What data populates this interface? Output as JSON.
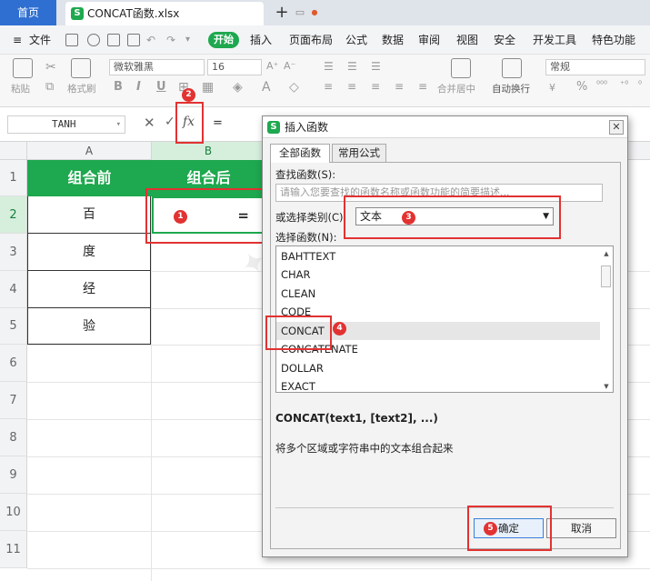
{
  "tabs": {
    "home": "首页",
    "file": "CONCAT函数.xlsx",
    "new_tab": "+"
  },
  "menu": {
    "file": "文件",
    "kaishi": "开始",
    "items": [
      "插入",
      "页面布局",
      "公式",
      "数据",
      "审阅",
      "视图",
      "安全",
      "开发工具",
      "特色功能"
    ]
  },
  "ribbon": {
    "paste": "粘贴",
    "format_painter": "格式刷",
    "font_name": "微软雅黑",
    "font_size": "16",
    "merge": "合并居中",
    "wrap": "自动换行",
    "number_format": "常规",
    "bold": "B",
    "italic": "I",
    "underline": "U",
    "percent": "%"
  },
  "formula_bar": {
    "name_box": "TANH",
    "fx": "fx",
    "cancel": "✕",
    "confirm": "✓",
    "formula": "="
  },
  "sheet": {
    "columns": [
      "A",
      "B"
    ],
    "rows": [
      "1",
      "2",
      "3",
      "4",
      "5",
      "6",
      "7",
      "8",
      "9",
      "10",
      "11"
    ],
    "header_a": "组合前",
    "header_b": "组合后",
    "a_values": [
      "百",
      "度",
      "经",
      "验"
    ],
    "b2_value": "="
  },
  "dialog": {
    "title": "插入函数",
    "close": "✕",
    "tab_all": "全部函数",
    "tab_common": "常用公式",
    "search_label": "查找函数(S):",
    "search_placeholder": "请输入您要查找的函数名称或函数功能的简要描述...",
    "category_label": "或选择类别(C):",
    "category_value": "文本",
    "function_label": "选择函数(N):",
    "functions": [
      "BAHTTEXT",
      "CHAR",
      "CLEAN",
      "CODE",
      "CONCAT",
      "CONCATENATE",
      "DOLLAR",
      "EXACT"
    ],
    "selected_function": "CONCAT",
    "syntax": "CONCAT(text1, [text2], ...)",
    "description": "将多个区域或字符串中的文本组合起来",
    "ok": "确定",
    "cancel": "取消"
  },
  "markers": [
    "1",
    "2",
    "3",
    "4",
    "5"
  ],
  "colors": {
    "accent_green": "#1ea84f",
    "highlight_red": "#e23232",
    "home_tab_blue": "#2f6fd1"
  }
}
